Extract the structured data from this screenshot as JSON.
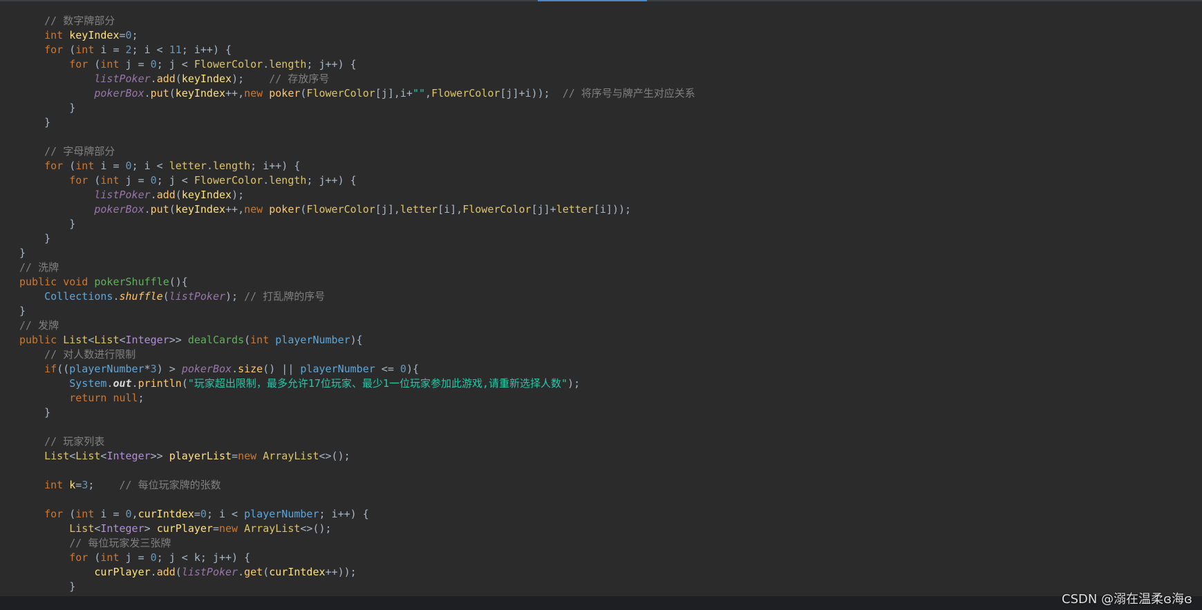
{
  "editor": {
    "lines": [
      {
        "indent": "    ",
        "tokens": [
          {
            "t": "// 数字牌部分",
            "c": "cmt"
          }
        ]
      },
      {
        "indent": "    ",
        "tokens": [
          {
            "t": "int ",
            "c": "kw"
          },
          {
            "t": "keyIndex",
            "c": "var"
          },
          {
            "t": "=",
            "c": "param"
          },
          {
            "t": "0",
            "c": "num"
          },
          {
            "t": ";",
            "c": "param"
          }
        ]
      },
      {
        "indent": "    ",
        "tokens": [
          {
            "t": "for ",
            "c": "kw"
          },
          {
            "t": "(",
            "c": "param"
          },
          {
            "t": "int ",
            "c": "kw"
          },
          {
            "t": "i = ",
            "c": "param"
          },
          {
            "t": "2",
            "c": "num"
          },
          {
            "t": "; i < ",
            "c": "param"
          },
          {
            "t": "11",
            "c": "num"
          },
          {
            "t": "; i++) {",
            "c": "param"
          }
        ]
      },
      {
        "indent": "        ",
        "tokens": [
          {
            "t": "for ",
            "c": "kw"
          },
          {
            "t": "(",
            "c": "param"
          },
          {
            "t": "int ",
            "c": "kw"
          },
          {
            "t": "j = ",
            "c": "param"
          },
          {
            "t": "0",
            "c": "num"
          },
          {
            "t": "; j < ",
            "c": "param"
          },
          {
            "t": "FlowerColor",
            "c": "cls"
          },
          {
            "t": ".",
            "c": "param"
          },
          {
            "t": "length",
            "c": "cls"
          },
          {
            "t": "; j++) {",
            "c": "param"
          }
        ]
      },
      {
        "indent": "            ",
        "tokens": [
          {
            "t": "listPoker",
            "c": "field"
          },
          {
            "t": ".",
            "c": "param"
          },
          {
            "t": "add",
            "c": "fn"
          },
          {
            "t": "(",
            "c": "param"
          },
          {
            "t": "keyIndex",
            "c": "var"
          },
          {
            "t": ");    ",
            "c": "param"
          },
          {
            "t": "// 存放序号",
            "c": "cmt"
          }
        ]
      },
      {
        "indent": "            ",
        "tokens": [
          {
            "t": "pokerBox",
            "c": "field"
          },
          {
            "t": ".",
            "c": "param"
          },
          {
            "t": "put",
            "c": "fn"
          },
          {
            "t": "(",
            "c": "param"
          },
          {
            "t": "keyIndex",
            "c": "var"
          },
          {
            "t": "++,",
            "c": "param"
          },
          {
            "t": "new ",
            "c": "kw"
          },
          {
            "t": "poker",
            "c": "fn"
          },
          {
            "t": "(",
            "c": "param"
          },
          {
            "t": "FlowerColor",
            "c": "cls"
          },
          {
            "t": "[j],i+",
            "c": "param"
          },
          {
            "t": "\"\"",
            "c": "str"
          },
          {
            "t": ",",
            "c": "param"
          },
          {
            "t": "FlowerColor",
            "c": "cls"
          },
          {
            "t": "[j]+i));  ",
            "c": "param"
          },
          {
            "t": "// 将序号与牌产生对应关系",
            "c": "cmt"
          }
        ]
      },
      {
        "indent": "        ",
        "tokens": [
          {
            "t": "}",
            "c": "param"
          }
        ]
      },
      {
        "indent": "    ",
        "tokens": [
          {
            "t": "}",
            "c": "param"
          }
        ]
      },
      {
        "indent": "",
        "tokens": []
      },
      {
        "indent": "    ",
        "tokens": [
          {
            "t": "// 字母牌部分",
            "c": "cmt"
          }
        ]
      },
      {
        "indent": "    ",
        "tokens": [
          {
            "t": "for ",
            "c": "kw"
          },
          {
            "t": "(",
            "c": "param"
          },
          {
            "t": "int ",
            "c": "kw"
          },
          {
            "t": "i = ",
            "c": "param"
          },
          {
            "t": "0",
            "c": "num"
          },
          {
            "t": "; i < ",
            "c": "param"
          },
          {
            "t": "letter",
            "c": "cls"
          },
          {
            "t": ".",
            "c": "param"
          },
          {
            "t": "length",
            "c": "cls"
          },
          {
            "t": "; i++) {",
            "c": "param"
          }
        ]
      },
      {
        "indent": "        ",
        "tokens": [
          {
            "t": "for ",
            "c": "kw"
          },
          {
            "t": "(",
            "c": "param"
          },
          {
            "t": "int ",
            "c": "kw"
          },
          {
            "t": "j = ",
            "c": "param"
          },
          {
            "t": "0",
            "c": "num"
          },
          {
            "t": "; j < ",
            "c": "param"
          },
          {
            "t": "FlowerColor",
            "c": "cls"
          },
          {
            "t": ".",
            "c": "param"
          },
          {
            "t": "length",
            "c": "cls"
          },
          {
            "t": "; j++) {",
            "c": "param"
          }
        ]
      },
      {
        "indent": "            ",
        "tokens": [
          {
            "t": "listPoker",
            "c": "field"
          },
          {
            "t": ".",
            "c": "param"
          },
          {
            "t": "add",
            "c": "fn"
          },
          {
            "t": "(",
            "c": "param"
          },
          {
            "t": "keyIndex",
            "c": "var"
          },
          {
            "t": ");",
            "c": "param"
          }
        ]
      },
      {
        "indent": "            ",
        "tokens": [
          {
            "t": "pokerBox",
            "c": "field"
          },
          {
            "t": ".",
            "c": "param"
          },
          {
            "t": "put",
            "c": "fn"
          },
          {
            "t": "(",
            "c": "param"
          },
          {
            "t": "keyIndex",
            "c": "var"
          },
          {
            "t": "++,",
            "c": "param"
          },
          {
            "t": "new ",
            "c": "kw"
          },
          {
            "t": "poker",
            "c": "fn"
          },
          {
            "t": "(",
            "c": "param"
          },
          {
            "t": "FlowerColor",
            "c": "cls"
          },
          {
            "t": "[j],",
            "c": "param"
          },
          {
            "t": "letter",
            "c": "cls"
          },
          {
            "t": "[i],",
            "c": "param"
          },
          {
            "t": "FlowerColor",
            "c": "cls"
          },
          {
            "t": "[j]+",
            "c": "param"
          },
          {
            "t": "letter",
            "c": "cls"
          },
          {
            "t": "[i]));",
            "c": "param"
          }
        ]
      },
      {
        "indent": "        ",
        "tokens": [
          {
            "t": "}",
            "c": "param"
          }
        ]
      },
      {
        "indent": "    ",
        "tokens": [
          {
            "t": "}",
            "c": "param"
          }
        ]
      },
      {
        "indent": "",
        "tokens": [
          {
            "t": "}",
            "c": "param"
          }
        ]
      },
      {
        "indent": "",
        "tokens": [
          {
            "t": "// 洗牌",
            "c": "cmt"
          }
        ]
      },
      {
        "indent": "",
        "tokens": [
          {
            "t": "public void ",
            "c": "kw"
          },
          {
            "t": "pokerShuffle",
            "c": "meth"
          },
          {
            "t": "(){",
            "c": "param"
          }
        ]
      },
      {
        "indent": "    ",
        "tokens": [
          {
            "t": "Collections",
            "c": "type"
          },
          {
            "t": ".",
            "c": "param"
          },
          {
            "t": "shuffle",
            "c": "static-it"
          },
          {
            "t": "(",
            "c": "param"
          },
          {
            "t": "listPoker",
            "c": "field"
          },
          {
            "t": "); ",
            "c": "param"
          },
          {
            "t": "// 打乱牌的序号",
            "c": "cmt"
          }
        ]
      },
      {
        "indent": "",
        "tokens": [
          {
            "t": "}",
            "c": "param"
          }
        ]
      },
      {
        "indent": "",
        "tokens": [
          {
            "t": "// 发牌",
            "c": "cmt"
          }
        ]
      },
      {
        "indent": "",
        "tokens": [
          {
            "t": "public ",
            "c": "kw"
          },
          {
            "t": "List",
            "c": "cls"
          },
          {
            "t": "<",
            "c": "param"
          },
          {
            "t": "List",
            "c": "cls"
          },
          {
            "t": "<",
            "c": "param"
          },
          {
            "t": "Integer",
            "c": "gen"
          },
          {
            "t": ">> ",
            "c": "param"
          },
          {
            "t": "dealCards",
            "c": "meth"
          },
          {
            "t": "(",
            "c": "param"
          },
          {
            "t": "int ",
            "c": "kw"
          },
          {
            "t": "playerNumber",
            "c": "type"
          },
          {
            "t": "){",
            "c": "param"
          }
        ]
      },
      {
        "indent": "    ",
        "tokens": [
          {
            "t": "// 对人数进行限制",
            "c": "cmt"
          }
        ]
      },
      {
        "indent": "    ",
        "tokens": [
          {
            "t": "if",
            "c": "kw"
          },
          {
            "t": "((",
            "c": "param"
          },
          {
            "t": "playerNumber",
            "c": "type"
          },
          {
            "t": "*",
            "c": "param"
          },
          {
            "t": "3",
            "c": "num"
          },
          {
            "t": ") > ",
            "c": "param"
          },
          {
            "t": "pokerBox",
            "c": "field"
          },
          {
            "t": ".",
            "c": "param"
          },
          {
            "t": "size",
            "c": "fn"
          },
          {
            "t": "() || ",
            "c": "param"
          },
          {
            "t": "playerNumber",
            "c": "type"
          },
          {
            "t": " <= ",
            "c": "param"
          },
          {
            "t": "0",
            "c": "num"
          },
          {
            "t": "){",
            "c": "param"
          }
        ]
      },
      {
        "indent": "        ",
        "tokens": [
          {
            "t": "System",
            "c": "type"
          },
          {
            "t": ".",
            "c": "param"
          },
          {
            "t": "out",
            "c": "static-bold"
          },
          {
            "t": ".",
            "c": "param"
          },
          {
            "t": "println",
            "c": "fn"
          },
          {
            "t": "(",
            "c": "param"
          },
          {
            "t": "\"玩家超出限制，最多允许17位玩家、最少1一位玩家参加此游戏,请重新选择人数\"",
            "c": "str"
          },
          {
            "t": ");",
            "c": "param"
          }
        ]
      },
      {
        "indent": "        ",
        "tokens": [
          {
            "t": "return null",
            "c": "kw"
          },
          {
            "t": ";",
            "c": "param"
          }
        ]
      },
      {
        "indent": "    ",
        "tokens": [
          {
            "t": "}",
            "c": "param"
          }
        ]
      },
      {
        "indent": "",
        "tokens": []
      },
      {
        "indent": "    ",
        "tokens": [
          {
            "t": "// 玩家列表",
            "c": "cmt"
          }
        ]
      },
      {
        "indent": "    ",
        "tokens": [
          {
            "t": "List",
            "c": "cls"
          },
          {
            "t": "<",
            "c": "param"
          },
          {
            "t": "List",
            "c": "cls"
          },
          {
            "t": "<",
            "c": "param"
          },
          {
            "t": "Integer",
            "c": "gen"
          },
          {
            "t": ">> ",
            "c": "param"
          },
          {
            "t": "playerList",
            "c": "var"
          },
          {
            "t": "=",
            "c": "param"
          },
          {
            "t": "new ",
            "c": "kw"
          },
          {
            "t": "ArrayList",
            "c": "cls"
          },
          {
            "t": "<>();",
            "c": "param"
          }
        ]
      },
      {
        "indent": "",
        "tokens": []
      },
      {
        "indent": "    ",
        "tokens": [
          {
            "t": "int ",
            "c": "kw"
          },
          {
            "t": "k",
            "c": "var"
          },
          {
            "t": "=",
            "c": "param"
          },
          {
            "t": "3",
            "c": "num"
          },
          {
            "t": ";    ",
            "c": "param"
          },
          {
            "t": "// 每位玩家牌的张数",
            "c": "cmt"
          }
        ]
      },
      {
        "indent": "",
        "tokens": []
      },
      {
        "indent": "    ",
        "tokens": [
          {
            "t": "for ",
            "c": "kw"
          },
          {
            "t": "(",
            "c": "param"
          },
          {
            "t": "int ",
            "c": "kw"
          },
          {
            "t": "i = ",
            "c": "param"
          },
          {
            "t": "0",
            "c": "num"
          },
          {
            "t": ",",
            "c": "param"
          },
          {
            "t": "curIntdex",
            "c": "var"
          },
          {
            "t": "=",
            "c": "param"
          },
          {
            "t": "0",
            "c": "num"
          },
          {
            "t": "; i < ",
            "c": "param"
          },
          {
            "t": "playerNumber",
            "c": "type"
          },
          {
            "t": "; i++) {",
            "c": "param"
          }
        ]
      },
      {
        "indent": "        ",
        "tokens": [
          {
            "t": "List",
            "c": "cls"
          },
          {
            "t": "<",
            "c": "param"
          },
          {
            "t": "Integer",
            "c": "gen"
          },
          {
            "t": "> ",
            "c": "param"
          },
          {
            "t": "curPlayer",
            "c": "var"
          },
          {
            "t": "=",
            "c": "param"
          },
          {
            "t": "new ",
            "c": "kw"
          },
          {
            "t": "ArrayList",
            "c": "cls"
          },
          {
            "t": "<>();",
            "c": "param"
          }
        ]
      },
      {
        "indent": "        ",
        "tokens": [
          {
            "t": "// 每位玩家发三张牌",
            "c": "cmt"
          }
        ]
      },
      {
        "indent": "        ",
        "tokens": [
          {
            "t": "for ",
            "c": "kw"
          },
          {
            "t": "(",
            "c": "param"
          },
          {
            "t": "int ",
            "c": "kw"
          },
          {
            "t": "j = ",
            "c": "param"
          },
          {
            "t": "0",
            "c": "num"
          },
          {
            "t": "; j < k; j++) {",
            "c": "param"
          }
        ]
      },
      {
        "indent": "            ",
        "tokens": [
          {
            "t": "curPlayer",
            "c": "var"
          },
          {
            "t": ".",
            "c": "param"
          },
          {
            "t": "add",
            "c": "fn"
          },
          {
            "t": "(",
            "c": "param"
          },
          {
            "t": "listPoker",
            "c": "field"
          },
          {
            "t": ".",
            "c": "param"
          },
          {
            "t": "get",
            "c": "fn"
          },
          {
            "t": "(",
            "c": "param"
          },
          {
            "t": "curIntdex",
            "c": "var"
          },
          {
            "t": "++));",
            "c": "param"
          }
        ]
      },
      {
        "indent": "        ",
        "tokens": [
          {
            "t": "}",
            "c": "param"
          }
        ]
      }
    ]
  },
  "watermark": {
    "text": "CSDN @溺在温柔ɞ海ɞ"
  },
  "colors": {
    "background": "#2b2b2b",
    "keyword": "#cc7832",
    "comment": "#808080",
    "string": "#2bc5a8",
    "number": "#6897bb"
  }
}
